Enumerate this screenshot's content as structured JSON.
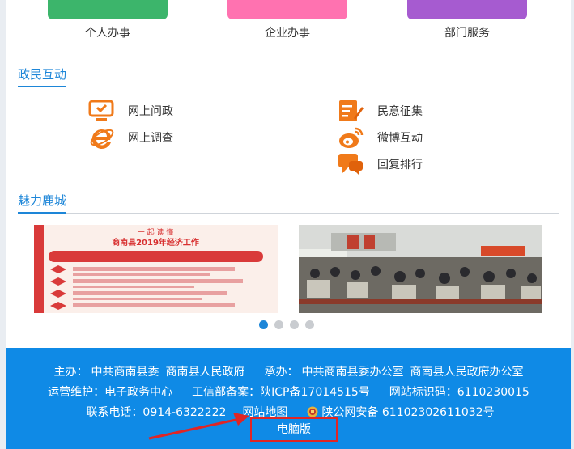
{
  "services": [
    {
      "label": "个人办事",
      "color": "#3cb56b"
    },
    {
      "label": "企业办事",
      "color": "#ff72b0"
    },
    {
      "label": "部门服务",
      "color": "#a65bd0"
    }
  ],
  "interaction": {
    "title": "政民互动",
    "items": [
      {
        "label": "网上问政",
        "icon": "computer-icon"
      },
      {
        "label": "民意征集",
        "icon": "survey-pen-icon"
      },
      {
        "label": "网上调查",
        "icon": "ie-icon"
      },
      {
        "label": "微博互动",
        "icon": "weibo-icon"
      },
      {
        "label": "回复排行",
        "icon": "chat-bubble-icon"
      }
    ]
  },
  "gallery": {
    "title": "魅力鹿城",
    "poster_line": "商南县2019年经济工作"
  },
  "footer": {
    "host_label": "主办：",
    "host_1": "中共商南县委",
    "host_2": "商南县人民政府",
    "organizer_label": "承办：",
    "organizer_1": "中共商南县委办公室",
    "organizer_2": "商南县人民政府办公室",
    "maintain": "运营维护：电子政务中心",
    "icp_label": "工信部备案：",
    "icp": "陕ICP备17014515号",
    "site_id": "网站标识码：6110230015",
    "phone": "联系电话：0914-6322222",
    "sitemap": "网站地图",
    "police": "陕公网安备 61102302611032号",
    "pc_version": "电脑版"
  },
  "colors": {
    "accent": "#1d86d8",
    "footer": "#0f8ae6",
    "highlight": "#e02525"
  }
}
